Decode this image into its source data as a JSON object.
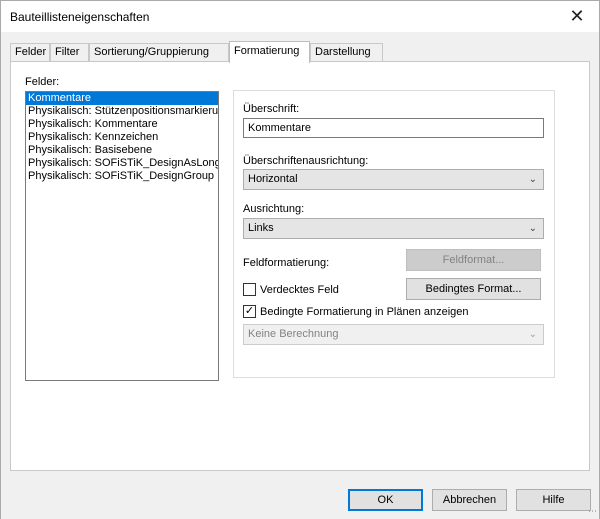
{
  "window": {
    "title": "Bauteillisteneigenschaften",
    "close_glyph": "✕"
  },
  "tabs": [
    {
      "label": "Felder"
    },
    {
      "label": "Filter"
    },
    {
      "label": "Sortierung/Gruppierung"
    },
    {
      "label": "Formatierung",
      "active": true
    },
    {
      "label": "Darstellung"
    }
  ],
  "fields_panel": {
    "label": "Felder:",
    "items": [
      "Kommentare",
      "Physikalisch: Stützenpositionsmarkierung",
      "Physikalisch: Kommentare",
      "Physikalisch: Kennzeichen",
      "Physikalisch: Basisebene",
      "Physikalisch: SOFiSTiK_DesignAsLongitudinal",
      "Physikalisch: SOFiSTiK_DesignGroup"
    ],
    "selected_index": 0
  },
  "format": {
    "heading_label": "Überschrift:",
    "heading_value": "Kommentare",
    "heading_align_label": "Überschriftenausrichtung:",
    "heading_align_value": "Horizontal",
    "align_label": "Ausrichtung:",
    "align_value": "Links",
    "field_format_label": "Feldformatierung:",
    "field_format_button": "Feldformat...",
    "hidden_field_label": "Verdecktes Feld",
    "hidden_field_checked": false,
    "conditional_format_button": "Bedingtes Format...",
    "conditional_show_label": "Bedingte Formatierung in Plänen anzeigen",
    "conditional_show_checked": true,
    "calculation_value": "Keine Berechnung"
  },
  "footer": {
    "ok": "OK",
    "cancel": "Abbrechen",
    "help": "Hilfe"
  },
  "icons": {
    "dropdown_arrow": "chevron-down-icon",
    "check": "checkmark-icon"
  },
  "colors": {
    "selection": "#0078d7"
  }
}
